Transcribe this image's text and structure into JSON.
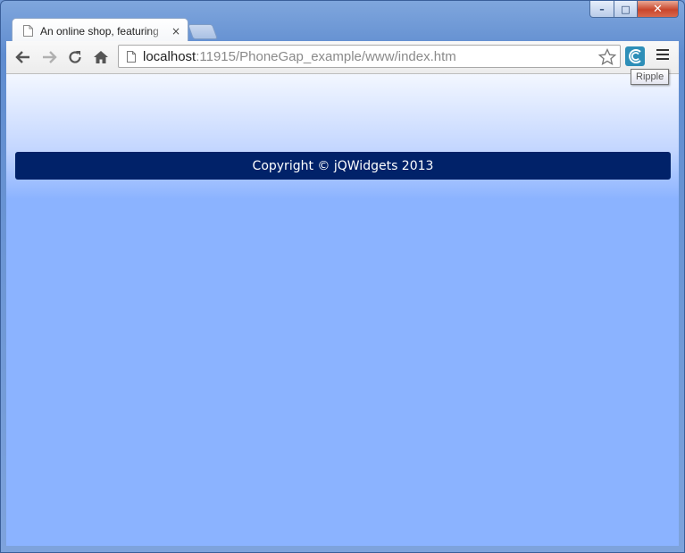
{
  "window": {
    "controls": {
      "minimize": "–",
      "maximize": "□",
      "close": "✕"
    }
  },
  "tabs": [
    {
      "title": "An online shop, featuring",
      "close": "×"
    }
  ],
  "toolbar": {
    "url_host": "localhost",
    "url_rest": ":11915/PhoneGap_example/www/index.htm",
    "extension_tooltip": "Ripple",
    "icons": [
      "back-icon",
      "forward-icon",
      "reload-icon",
      "home-icon",
      "page-icon",
      "star-icon",
      "ripple-extension-icon",
      "menu-icon"
    ]
  },
  "page": {
    "footer_text": "Copyright © jQWidgets 2013"
  },
  "colors": {
    "footer_bg": "#012269",
    "page_bg": "#8bb3ff"
  }
}
